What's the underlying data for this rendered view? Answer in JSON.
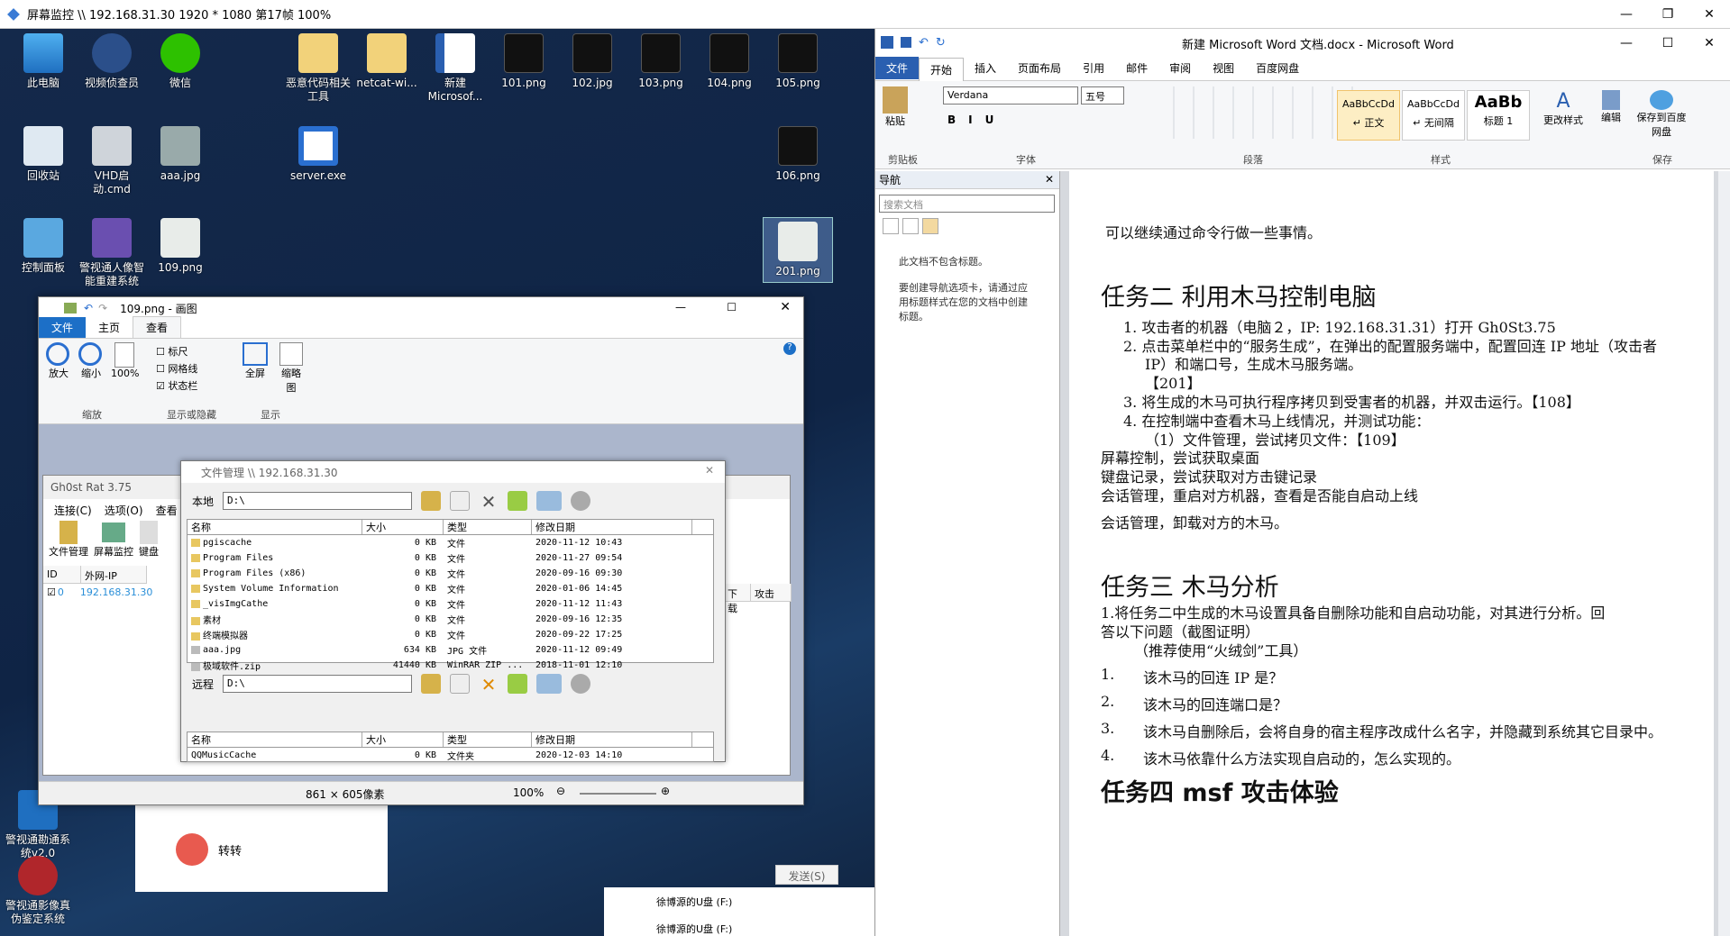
{
  "viewer": {
    "title": "屏幕监控 \\\\ 192.168.31.30 1920 * 1080 第17帧 100%"
  },
  "winctrl": {
    "min": "—",
    "max": "❐",
    "close": "✕"
  },
  "desktop": {
    "icons": [
      {
        "label": "此电脑"
      },
      {
        "label": "视频侦查员"
      },
      {
        "label": "微信"
      },
      {
        "label": "恶意代码相关工具"
      },
      {
        "label": "netcat-wi..."
      },
      {
        "label": "新建 Microsof..."
      },
      {
        "label": "101.png"
      },
      {
        "label": "102.jpg"
      },
      {
        "label": "103.png"
      },
      {
        "label": "104.png"
      },
      {
        "label": "105.png"
      },
      {
        "label": "回收站"
      },
      {
        "label": "VHD启动.cmd"
      },
      {
        "label": "aaa.jpg"
      },
      {
        "label": "server.exe"
      },
      {
        "label": "106.png"
      },
      {
        "label": "控制面板"
      },
      {
        "label": "警视通人像智能重建系统"
      },
      {
        "label": "109.png"
      },
      {
        "label": "201.png"
      },
      {
        "label": "警视通勘通系统v2.0"
      },
      {
        "label": "警视通影像真伪鉴定系统"
      }
    ]
  },
  "paint": {
    "title": "109.png - 画图",
    "tabs": [
      "文件",
      "主页",
      "查看"
    ],
    "zoom": {
      "in": "放大",
      "out": "缩小",
      "pct": "100%",
      "group": "缩放"
    },
    "show": {
      "ruler": "标尺",
      "grid": "网格线",
      "statusbar": "状态栏",
      "group": "显示或隐藏"
    },
    "display": {
      "full": "全屏",
      "thumb": "缩略图",
      "group": "显示"
    },
    "status": {
      "size": "861 × 605像素",
      "zoom": "100%"
    }
  },
  "ghost": {
    "title": "Gh0st Rat 3.75",
    "menu": [
      "连接(C)",
      "选项(O)",
      "查看"
    ],
    "tools": [
      "文件管理",
      "屏幕监控",
      "键盘"
    ],
    "cols": [
      "ID",
      "外网-IP"
    ],
    "row": {
      "id": "0",
      "ip": "192.168.31.30"
    },
    "extra_cols": [
      "下载",
      "攻击"
    ],
    "dash": "--"
  },
  "fm": {
    "title": "文件管理 \\\\ 192.168.31.30",
    "local_label": "本地",
    "remote_label": "远程",
    "path": "D:\\",
    "cols": [
      "名称",
      "大小",
      "类型",
      "修改日期"
    ],
    "rows": [
      {
        "name": "pgiscache",
        "size": "0 KB",
        "type": "文件",
        "date": "2020-11-12 10:43"
      },
      {
        "name": "Program Files",
        "size": "0 KB",
        "type": "文件",
        "date": "2020-11-27 09:54"
      },
      {
        "name": "Program Files (x86)",
        "size": "0 KB",
        "type": "文件",
        "date": "2020-09-16 09:30"
      },
      {
        "name": "System Volume Information",
        "size": "0 KB",
        "type": "文件",
        "date": "2020-01-06 14:45"
      },
      {
        "name": "_visImgCathe",
        "size": "0 KB",
        "type": "文件",
        "date": "2020-11-12 11:43"
      },
      {
        "name": "素材",
        "size": "0 KB",
        "type": "文件",
        "date": "2020-09-16 12:35"
      },
      {
        "name": "终端模拟器",
        "size": "0 KB",
        "type": "文件",
        "date": "2020-09-22 17:25"
      },
      {
        "name": "aaa.jpg",
        "size": "634 KB",
        "type": "JPG 文件",
        "date": "2020-11-12 09:49"
      },
      {
        "name": "极域软件.zip",
        "size": "41440 KB",
        "type": "WinRAR ZIP ...",
        "date": "2018-11-01 12:10"
      }
    ],
    "remote_row": {
      "name": "QQMusicCache",
      "size": "0 KB",
      "type": "文件夹",
      "date": "2020-12-03 14:10"
    }
  },
  "chat": {
    "name": "转转",
    "send": "发送(S)",
    "drive1": "徐博源的U盘 (F:)",
    "drive2": "徐博源的U盘 (F:)"
  },
  "word": {
    "title": "新建 Microsoft Word 文档.docx - Microsoft Word",
    "tabs": [
      "文件",
      "开始",
      "插入",
      "页面布局",
      "引用",
      "邮件",
      "审阅",
      "视图",
      "百度网盘"
    ],
    "font": "Verdana",
    "size": "五号",
    "styles": [
      {
        "sample": "AaBbCcDd",
        "name": "↵ 正文"
      },
      {
        "sample": "AaBbCcDd",
        "name": "↵ 无间隔"
      },
      {
        "sample": "AaBb",
        "name": "标题 1"
      }
    ],
    "groups": [
      "剪贴板",
      "字体",
      "段落",
      "样式",
      "保存"
    ],
    "btns": {
      "paste": "粘贴",
      "change_style": "更改样式",
      "edit": "编辑",
      "save_cloud": "保存到百度网盘"
    },
    "nav": {
      "title": "导航",
      "search": "搜索文档",
      "msg1": "此文档不包含标题。",
      "msg2": "要创建导航选项卡，请通过应用标题样式在您的文档中创建标题。"
    },
    "doc": [
      "可以继续通过命令行做一些事情。",
      "任务二  利用木马控制电脑",
      "1.  攻击者的机器（电脑２，IP: 192.168.31.31）打开 Gh0St3.75",
      "2.  点击菜单栏中的“服务生成”，在弹出的配置服务端中，配置回连 IP 地址（攻击者",
      "IP）和端口号，生成木马服务端。",
      "【201】",
      "3.  将生成的木马可执行程序拷贝到受害者的机器，并双击运行。【108】",
      "4.  在控制端中查看木马上线情况，并测试功能：",
      "（1）文件管理，尝试拷贝文件：【109】",
      "屏幕控制，尝试获取桌面",
      "键盘记录，尝试获取对方击键记录",
      "会话管理，重启对方机器，查看是否能自启动上线",
      "会话管理，卸载对方的木马。",
      "任务三  木马分析",
      "1.将任务二中生成的木马设置具备自删除功能和自启动功能，对其进行分析。回",
      "答以下问题（截图证明）",
      "（推荐使用“火绒剑”工具）",
      "1.",
      "该木马的回连 IP 是？",
      "2.",
      "该木马的回连端口是？",
      "3.",
      "该木马自删除后，会将自身的宿主程序改成什么名字，并隐藏到系统其它目录中。",
      "4.",
      "该木马依靠什么方法实现自启动的，怎么实现的。",
      "任务四  msf 攻击体验"
    ]
  }
}
